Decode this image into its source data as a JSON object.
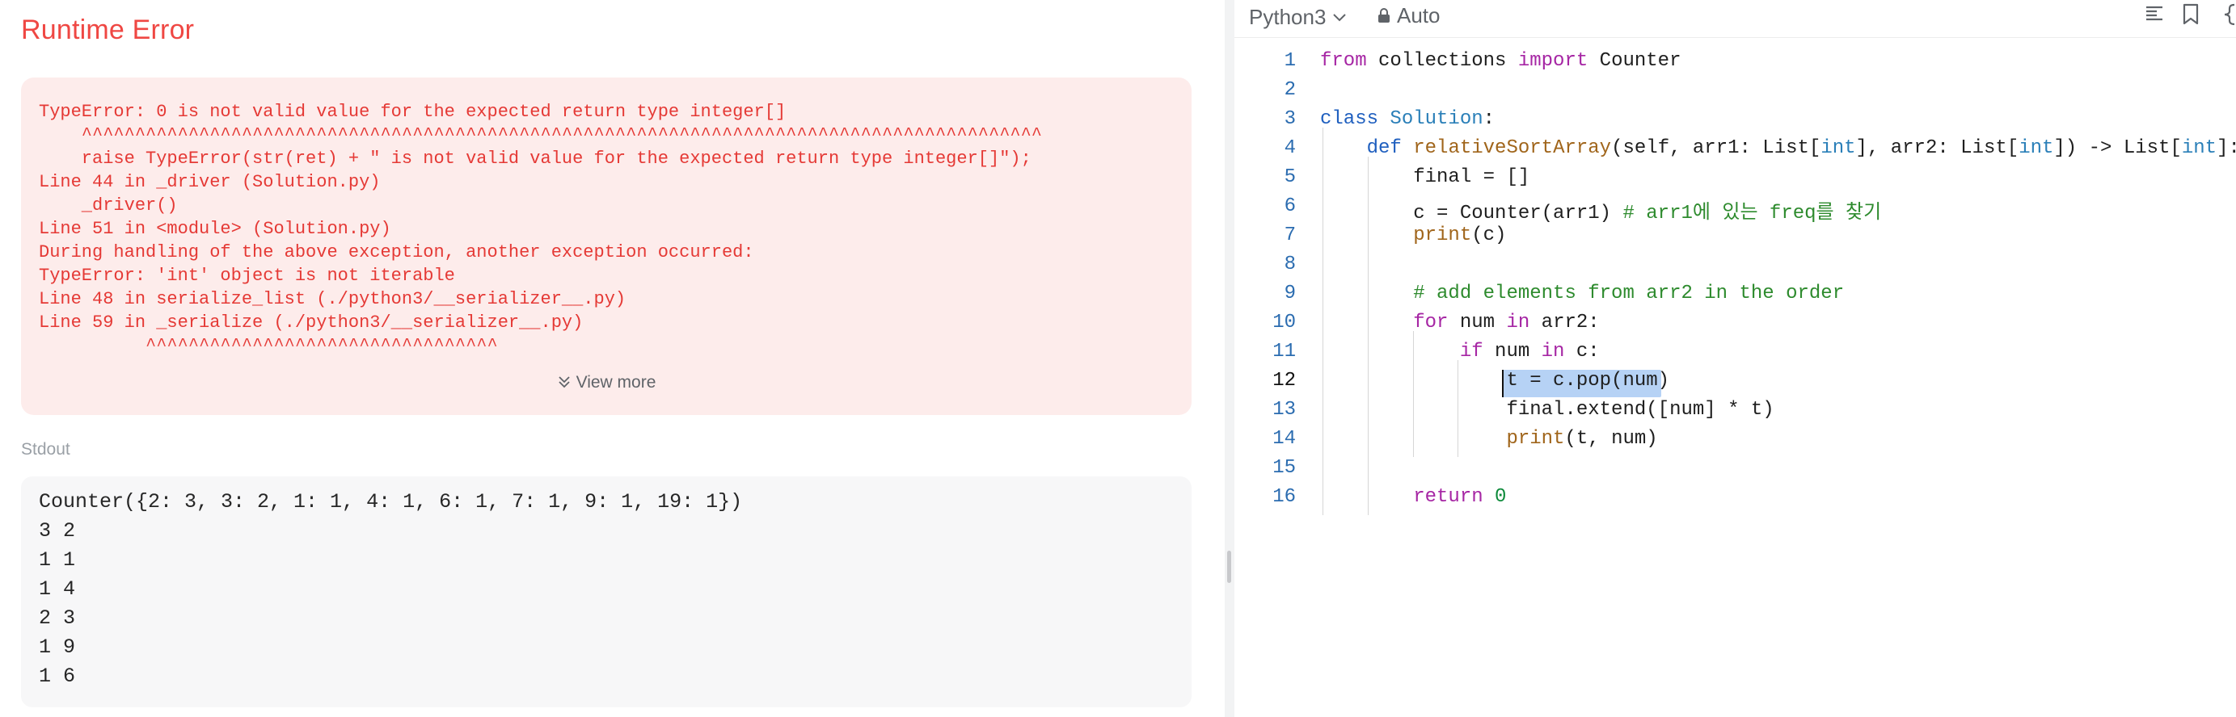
{
  "result": {
    "title": "Runtime Error",
    "error_text": "TypeError: 0 is not valid value for the expected return type integer[]\n    ^^^^^^^^^^^^^^^^^^^^^^^^^^^^^^^^^^^^^^^^^^^^^^^^^^^^^^^^^^^^^^^^^^^^^^^^^^^^^^^^^^^^^^^^^^\n    raise TypeError(str(ret) + \" is not valid value for the expected return type integer[]\");\nLine 44 in _driver (Solution.py)\n    _driver()\nLine 51 in <module> (Solution.py)\nDuring handling of the above exception, another exception occurred:\nTypeError: 'int' object is not iterable\nLine 48 in serialize_list (./python3/__serializer__.py)\nLine 59 in _serialize (./python3/__serializer__.py)\n          ^^^^^^^^^^^^^^^^^^^^^^^^^^^^^^^^^",
    "view_more": "View more",
    "stdout_label": "Stdout",
    "stdout_text": "Counter({2: 3, 3: 2, 1: 1, 4: 1, 6: 1, 7: 1, 9: 1, 19: 1})\n3 2\n1 1\n1 4\n2 3\n1 9\n1 6"
  },
  "editor": {
    "language": "Python3",
    "mode": "Auto",
    "icons": [
      "format-icon",
      "bookmark-icon",
      "braces-icon"
    ],
    "selected_text": "t = c.pop(num)",
    "active_line": 12,
    "line_numbers": [
      "1",
      "2",
      "3",
      "4",
      "5",
      "6",
      "7",
      "8",
      "9",
      "10",
      "11",
      "12",
      "13",
      "14",
      "15",
      "16"
    ],
    "code": [
      "from collections import Counter",
      "",
      "class Solution:",
      "    def relativeSortArray(self, arr1: List[int], arr2: List[int]) -> List[int]:",
      "        final = []",
      "        c = Counter(arr1) # arr1에 있는 freq를 찾기",
      "        print(c)",
      "",
      "        # add elements from arr2 in the order",
      "        for num in arr2:",
      "            if num in c:",
      "                t = c.pop(num)",
      "                final.extend([num] * t)",
      "                print(t, num)",
      "",
      "        return 0"
    ]
  }
}
